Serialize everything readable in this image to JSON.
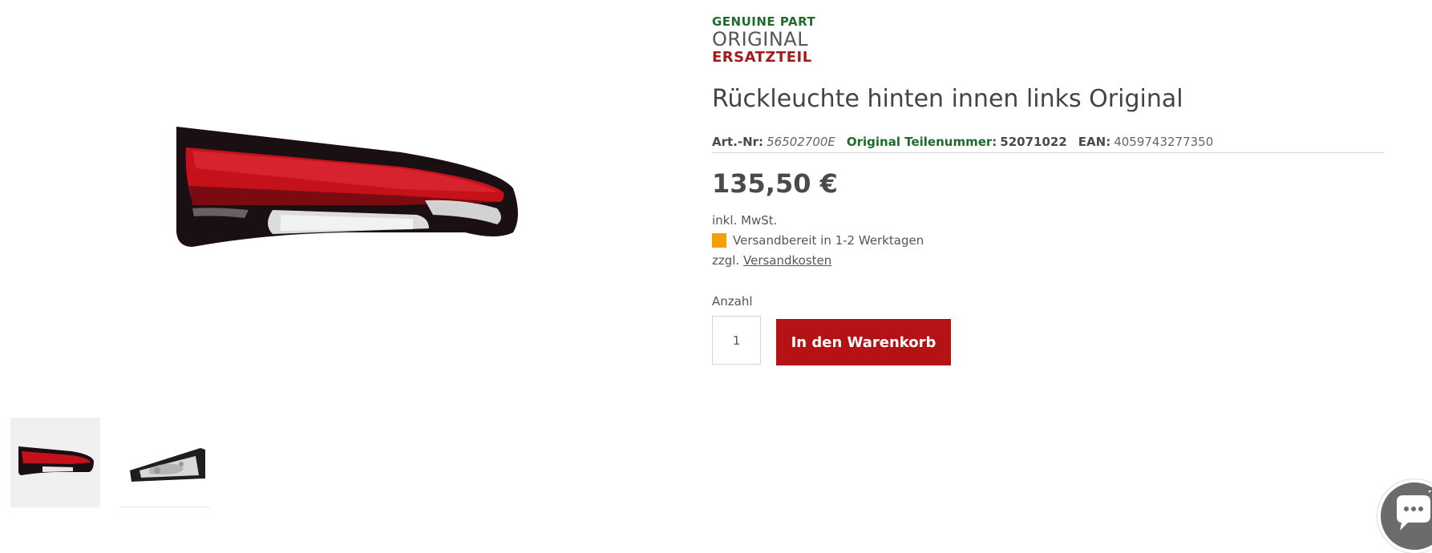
{
  "brand_badge": {
    "line1": "GENUINE PART",
    "line2": "ORIGINAL",
    "line3": "ERSATZTEIL"
  },
  "product": {
    "title": "Rückleuchte hinten innen links Original",
    "art_nr_label": "Art.-Nr:",
    "art_nr_value": "56502700E",
    "oe_label": "Original Teilenummer:",
    "oe_value": "52071022",
    "ean_label": "EAN:",
    "ean_value": "4059743277350",
    "price": "135,50 €",
    "tax_note": "inkl. MwSt.",
    "delivery_text": "Versandbereit in 1-2 Werktagen",
    "delivery_color": "#f5a000",
    "shipping_prefix": "zzgl.",
    "shipping_link": "Versandkosten"
  },
  "purchase": {
    "qty_label": "Anzahl",
    "qty_value": "1",
    "cart_button": "In den Warenkorb",
    "accent_color": "#b51215"
  },
  "gallery": {
    "main_image": "tail-light-image",
    "thumbnails": [
      "tail-light-front-thumbnail",
      "tail-light-back-thumbnail"
    ]
  },
  "chat": {
    "icon": "chat-bubble-icon"
  }
}
